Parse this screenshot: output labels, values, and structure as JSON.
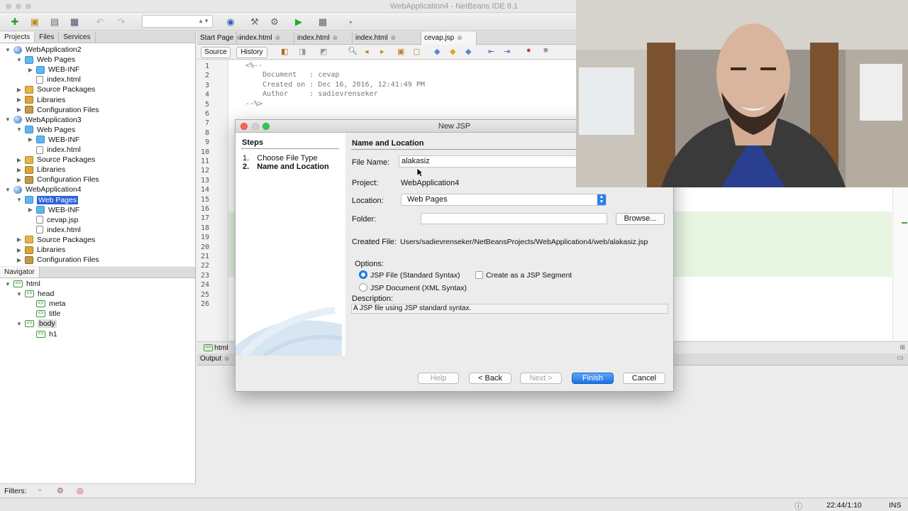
{
  "window": {
    "title": "WebApplication4 - NetBeans IDE 8.1"
  },
  "projects_panel": {
    "tabs": [
      "Projects",
      "Files",
      "Services"
    ],
    "tree": [
      {
        "label": "WebApplication2",
        "icon": "project-icon",
        "indent": 0,
        "expanded": true
      },
      {
        "label": "Web Pages",
        "icon": "folder-icon",
        "indent": 1,
        "expanded": true
      },
      {
        "label": "WEB-INF",
        "icon": "folder-icon",
        "indent": 2,
        "expanded": false
      },
      {
        "label": "index.html",
        "icon": "html-file-icon",
        "indent": 2
      },
      {
        "label": "Source Packages",
        "icon": "package-icon",
        "indent": 1,
        "expanded": false
      },
      {
        "label": "Libraries",
        "icon": "library-icon",
        "indent": 1,
        "expanded": false
      },
      {
        "label": "Configuration Files",
        "icon": "config-icon",
        "indent": 1,
        "expanded": false
      },
      {
        "label": "WebApplication3",
        "icon": "project-icon",
        "indent": 0,
        "expanded": true
      },
      {
        "label": "Web Pages",
        "icon": "folder-icon",
        "indent": 1,
        "expanded": true
      },
      {
        "label": "WEB-INF",
        "icon": "folder-icon",
        "indent": 2,
        "expanded": false
      },
      {
        "label": "index.html",
        "icon": "html-file-icon",
        "indent": 2
      },
      {
        "label": "Source Packages",
        "icon": "package-icon",
        "indent": 1,
        "expanded": false
      },
      {
        "label": "Libraries",
        "icon": "library-icon",
        "indent": 1,
        "expanded": false
      },
      {
        "label": "Configuration Files",
        "icon": "config-icon",
        "indent": 1,
        "expanded": false
      },
      {
        "label": "WebApplication4",
        "icon": "project-icon",
        "indent": 0,
        "expanded": true
      },
      {
        "label": "Web Pages",
        "icon": "folder-icon",
        "indent": 1,
        "expanded": true,
        "selected": true
      },
      {
        "label": "WEB-INF",
        "icon": "folder-icon",
        "indent": 2,
        "expanded": false
      },
      {
        "label": "cevap.jsp",
        "icon": "jsp-file-icon",
        "indent": 2
      },
      {
        "label": "index.html",
        "icon": "html-file-icon",
        "indent": 2
      },
      {
        "label": "Source Packages",
        "icon": "package-icon",
        "indent": 1,
        "expanded": false
      },
      {
        "label": "Libraries",
        "icon": "library-icon",
        "indent": 1,
        "expanded": false
      },
      {
        "label": "Configuration Files",
        "icon": "config-icon",
        "indent": 1,
        "expanded": false
      }
    ]
  },
  "navigator": {
    "title": "Navigator",
    "tree": [
      {
        "label": "html",
        "indent": 0,
        "expanded": true
      },
      {
        "label": "head",
        "indent": 1,
        "expanded": true
      },
      {
        "label": "meta",
        "indent": 2
      },
      {
        "label": "title",
        "indent": 2
      },
      {
        "label": "body",
        "indent": 1,
        "expanded": true,
        "highlight": true
      },
      {
        "label": "h1",
        "indent": 2
      }
    ],
    "filters_label": "Filters:"
  },
  "editor": {
    "tabs": [
      {
        "label": "Start Page",
        "active": false
      },
      {
        "label": "index.html",
        "active": false
      },
      {
        "label": "index.html",
        "active": false
      },
      {
        "label": "index.html",
        "active": false
      },
      {
        "label": "cevap.jsp",
        "active": true
      }
    ],
    "source_label": "Source",
    "history_label": "History",
    "line_numbers": [
      "1",
      "2",
      "3",
      "4",
      "5",
      "6",
      "7",
      "8",
      "9",
      "10",
      "11",
      "12",
      "13",
      "14",
      "15",
      "16",
      "17",
      "18",
      "19",
      "20",
      "21",
      "22",
      "23",
      "24",
      "25",
      "26"
    ],
    "code_lines": [
      "<%--",
      "    Document   : cevap",
      "    Created on : Dec 16, 2016, 12:41:49 PM",
      "    Author     : sadievrenseker",
      "--%>"
    ],
    "breadcrumb": "html"
  },
  "output": {
    "title": "Output"
  },
  "dialog": {
    "title": "New JSP",
    "steps_title": "Steps",
    "steps": [
      {
        "num": "1.",
        "label": "Choose File Type",
        "current": false
      },
      {
        "num": "2.",
        "label": "Name and Location",
        "current": true
      }
    ],
    "section_title": "Name and Location",
    "file_name_label": "File Name:",
    "file_name_value": "alakasiz",
    "project_label": "Project:",
    "project_value": "WebApplication4",
    "location_label": "Location:",
    "location_value": "Web Pages",
    "folder_label": "Folder:",
    "folder_value": "",
    "browse_label": "Browse...",
    "created_file_label": "Created File:",
    "created_file_value": "Users/sadievrenseker/NetBeansProjects/WebApplication4/web/alakasiz.jsp",
    "options_label": "Options:",
    "option_standard": "JSP File (Standard Syntax)",
    "option_segment": "Create as a JSP Segment",
    "option_xml": "JSP Document (XML Syntax)",
    "selected_option": "standard",
    "description_label": "Description:",
    "description_value": "A JSP file using JSP standard syntax.",
    "buttons": {
      "help": "Help",
      "back": "< Back",
      "next": "Next >",
      "finish": "Finish",
      "cancel": "Cancel"
    }
  },
  "status": {
    "position": "22:44/1:10",
    "mode": "INS"
  },
  "colors": {
    "selection": "#2b63d9",
    "finish_button": "#1d72e3",
    "green_highlight": "#e7f5e1"
  }
}
